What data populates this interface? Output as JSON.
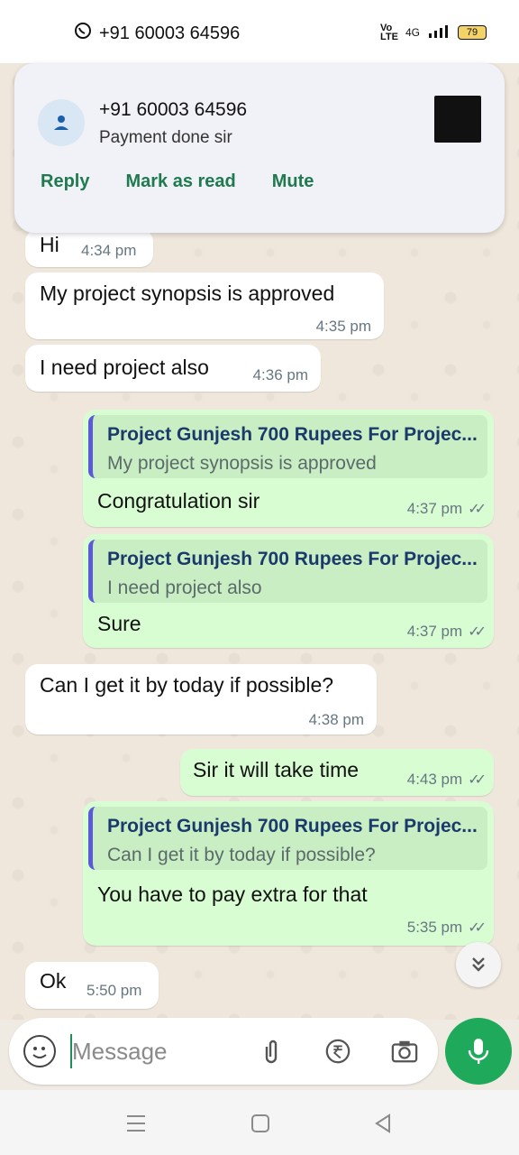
{
  "status_bar": {
    "phone_number": "+91 60003 64596",
    "network": "4G",
    "battery": "79"
  },
  "notification": {
    "title": "+91 60003 64596",
    "text": "Payment done sir",
    "actions": [
      "Reply",
      "Mark as read",
      "Mute"
    ]
  },
  "messages": [
    {
      "direction": "in",
      "text": "Hi",
      "time": "4:34 pm"
    },
    {
      "direction": "in",
      "text": "My project synopsis is approved",
      "time": "4:35 pm"
    },
    {
      "direction": "in",
      "text": "I need project also",
      "time": "4:36 pm"
    },
    {
      "direction": "out",
      "quote_title": "Project Gunjesh 700 Rupees For Projec...",
      "quote_text": "My project synopsis is approved",
      "text": "Congratulation sir",
      "time": "4:37 pm"
    },
    {
      "direction": "out",
      "quote_title": "Project Gunjesh 700 Rupees For Projec...",
      "quote_text": "I need project also",
      "text": "Sure",
      "time": "4:37 pm"
    },
    {
      "direction": "in",
      "text": "Can I get it by today if possible?",
      "time": "4:38 pm"
    },
    {
      "direction": "out",
      "text": "Sir it will take time",
      "time": "4:43 pm"
    },
    {
      "direction": "out",
      "quote_title": "Project Gunjesh 700 Rupees For Projec...",
      "quote_text": "Can I get it by today if possible?",
      "text": "You have to pay extra for that",
      "time": "5:35 pm"
    },
    {
      "direction": "in",
      "text": "Ok",
      "time": "5:50 pm"
    }
  ],
  "input": {
    "placeholder": "Message"
  },
  "icons": {
    "emoji": "sticker-icon",
    "attach": "paperclip-icon",
    "payment": "rupee-icon",
    "camera": "camera-icon",
    "mic": "microphone-icon",
    "scroll": "double-chevron-down-icon"
  },
  "colors": {
    "outgoing_bubble": "#d9fdd3",
    "incoming_bubble": "#ffffff",
    "accent_green": "#1faa5b",
    "quote_bar": "#5b59d8"
  }
}
